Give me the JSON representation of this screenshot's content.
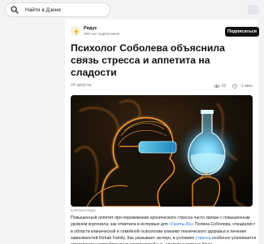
{
  "search": {
    "placeholder": "Найти в Дзене"
  },
  "channel": {
    "name": "Ридус",
    "subscribers": "293 тыс подписчиков",
    "subscribe_label": "Подписаться"
  },
  "article": {
    "title": "Психолог Соболева объяснила связь стресса и аппетита на сладости",
    "date": "24 августа",
    "views": "15",
    "read_time": "~1 мин",
    "image_caption": "Кочетков Ридус",
    "paragraph1": {
      "text_a": "Повышенный аппетит при переживании хронического стресса часто связан с повышенным уровнем кортизола, как отметила в интервью для ",
      "link": "«Газеты.Ru»",
      "text_b": " Полина Соболева, специалист в области клинической и семейной психологии клиники технического здоровья и лечения зависимостей Rehab Family. Как указывает эксперт, в условиях ",
      "highlight": "стресса",
      "text_c": " особенно усиливается стремление к потреблению высококалорийных, сладких и жирных блюд."
    }
  },
  "colors": {
    "accent_link": "#1b6fd6",
    "button_bg": "#111111",
    "glow": "#ff9a2e"
  },
  "icons": {
    "search": "search-icon",
    "logo": "lightning-logo-icon",
    "views": "eye-icon",
    "time": "clock-icon"
  }
}
